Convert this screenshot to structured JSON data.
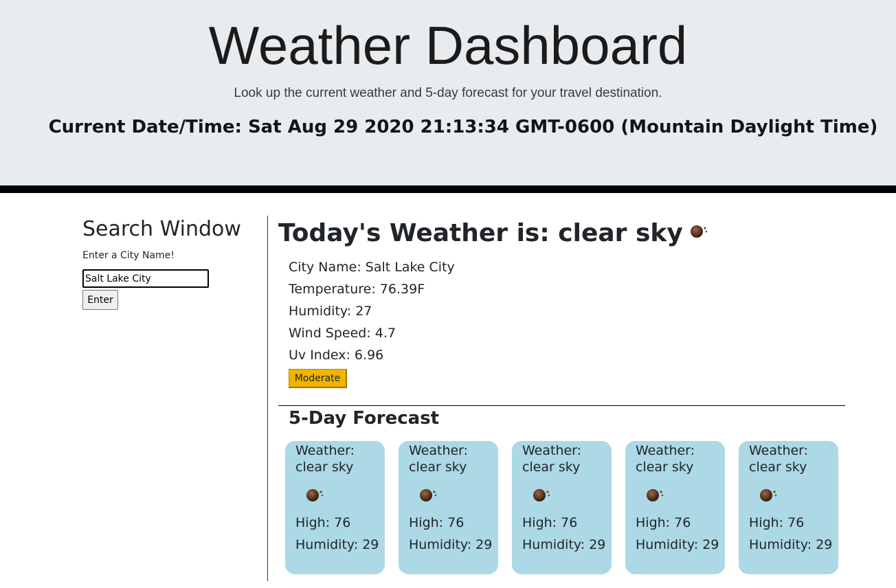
{
  "header": {
    "title": "Weather Dashboard",
    "subtitle": "Look up the current weather and 5-day forecast for your travel destination.",
    "datetime": "Current Date/Time: Sat Aug 29 2020 21:13:34 GMT-0600 (Mountain Daylight Time)"
  },
  "search": {
    "title": "Search Window",
    "label": "Enter a City Name!",
    "input_value": "Salt Lake City",
    "button_label": "Enter"
  },
  "today": {
    "title": "Today's Weather is: clear sky",
    "icon": "clear-sky-night-icon",
    "city": "City Name: Salt Lake City",
    "temperature": "Temperature: 76.39F",
    "humidity": "Humidity: 27",
    "wind": "Wind Speed: 4.7",
    "uv": "Uv Index: 6.96",
    "uv_badge": "Moderate",
    "uv_badge_color": "#f0b400"
  },
  "forecast": {
    "title": "5-Day Forecast",
    "card_color": "#add8e6",
    "days": [
      {
        "weather": "Weather: clear sky",
        "icon": "clear-sky-night-icon",
        "high": "High: 76",
        "humidity": "Humidity: 29"
      },
      {
        "weather": "Weather: clear sky",
        "icon": "clear-sky-night-icon",
        "high": "High: 76",
        "humidity": "Humidity: 29"
      },
      {
        "weather": "Weather: clear sky",
        "icon": "clear-sky-night-icon",
        "high": "High: 76",
        "humidity": "Humidity: 29"
      },
      {
        "weather": "Weather: clear sky",
        "icon": "clear-sky-night-icon",
        "high": "High: 76",
        "humidity": "Humidity: 29"
      },
      {
        "weather": "Weather: clear sky",
        "icon": "clear-sky-night-icon",
        "high": "High: 76",
        "humidity": "Humidity: 29"
      }
    ]
  }
}
